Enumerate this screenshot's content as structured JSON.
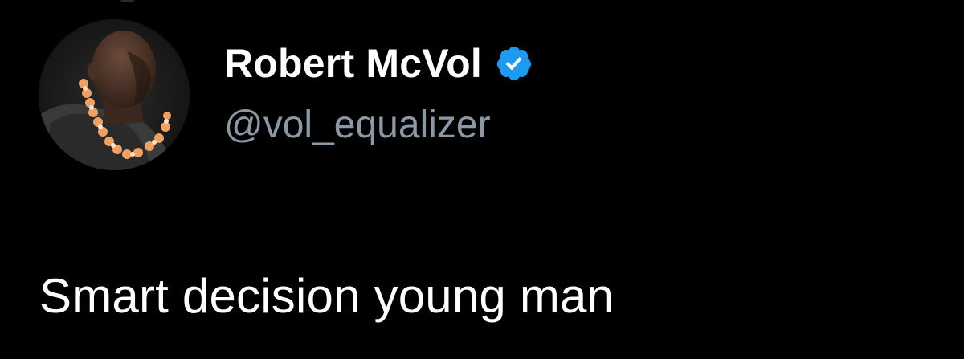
{
  "tweet": {
    "author": {
      "display_name": "Robert McVol",
      "handle": "@vol_equalizer",
      "verified": true,
      "avatar_icon": "profile-photo"
    },
    "text": "Smart decision young man"
  },
  "colors": {
    "background": "#000000",
    "primary_text": "#ffffff",
    "secondary_text": "#8b98a5",
    "verified_badge": "#1d9bf0"
  }
}
